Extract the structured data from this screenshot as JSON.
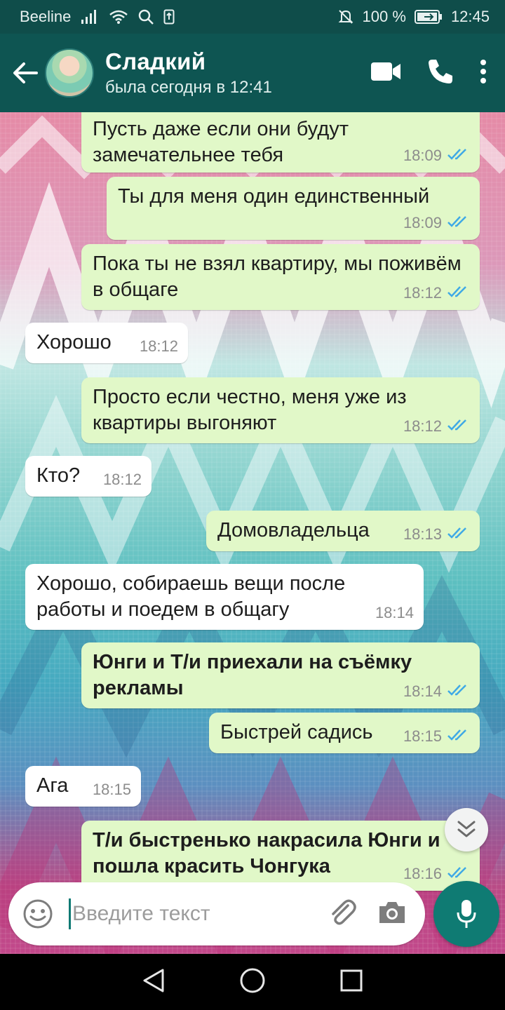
{
  "status_bar": {
    "carrier": "Beeline",
    "battery": "100 %",
    "time": "12:45",
    "icons": [
      "signal-icon",
      "wifi-icon",
      "search-icon",
      "sim-icon",
      "mute-bell-icon",
      "battery-icon"
    ]
  },
  "header": {
    "contact_name": "Сладкий",
    "last_seen": "была сегодня в 12:41",
    "icons": [
      "back-arrow-icon",
      "video-call-icon",
      "phone-icon",
      "more-vert-icon"
    ]
  },
  "messages": [
    {
      "dir": "out",
      "text": "Пусть даже если они будут замечательнее тебя",
      "time": "18:09",
      "read": true
    },
    {
      "dir": "out",
      "text": "Ты для меня один единственный",
      "time": "18:09",
      "read": true
    },
    {
      "dir": "out",
      "text": "Пока ты не взял квартиру, мы поживём в общаге",
      "time": "18:12",
      "read": true
    },
    {
      "dir": "in",
      "text": "Хорошо",
      "time": "18:12"
    },
    {
      "dir": "out",
      "text": "Просто если честно, меня уже из квартиры выгоняют",
      "time": "18:12",
      "read": true
    },
    {
      "dir": "in",
      "text": "Кто?",
      "time": "18:12"
    },
    {
      "dir": "out",
      "text": "Домовладельца",
      "time": "18:13",
      "read": true
    },
    {
      "dir": "in",
      "text": "Хорошо, собираешь вещи после работы и поедем в общагу",
      "time": "18:14"
    },
    {
      "dir": "out",
      "text": "Юнги и Т/и приехали на съёмку рекламы",
      "time": "18:14",
      "read": true,
      "bold": true
    },
    {
      "dir": "out",
      "text": "Быстрей садись",
      "time": "18:15",
      "read": true
    },
    {
      "dir": "in",
      "text": "Ага",
      "time": "18:15"
    },
    {
      "dir": "out",
      "text": "Т/и быстренько накрасила Юнги и пошла красить Чонгука",
      "time": "18:16",
      "read": true,
      "bold": true
    }
  ],
  "input": {
    "placeholder": "Введите текст",
    "icons": [
      "emoji-icon",
      "attach-icon",
      "camera-icon",
      "mic-icon"
    ]
  },
  "navigation": {
    "icons": [
      "back-triangle-icon",
      "home-circle-icon",
      "recents-square-icon"
    ]
  },
  "colors": {
    "header": "#0e5552",
    "status_bar": "#0f4d4a",
    "outgoing_bubble": "#e1f8c8",
    "incoming_bubble": "#ffffff",
    "read_ticks": "#3fa9e6",
    "mic_button": "#0f7b73"
  }
}
